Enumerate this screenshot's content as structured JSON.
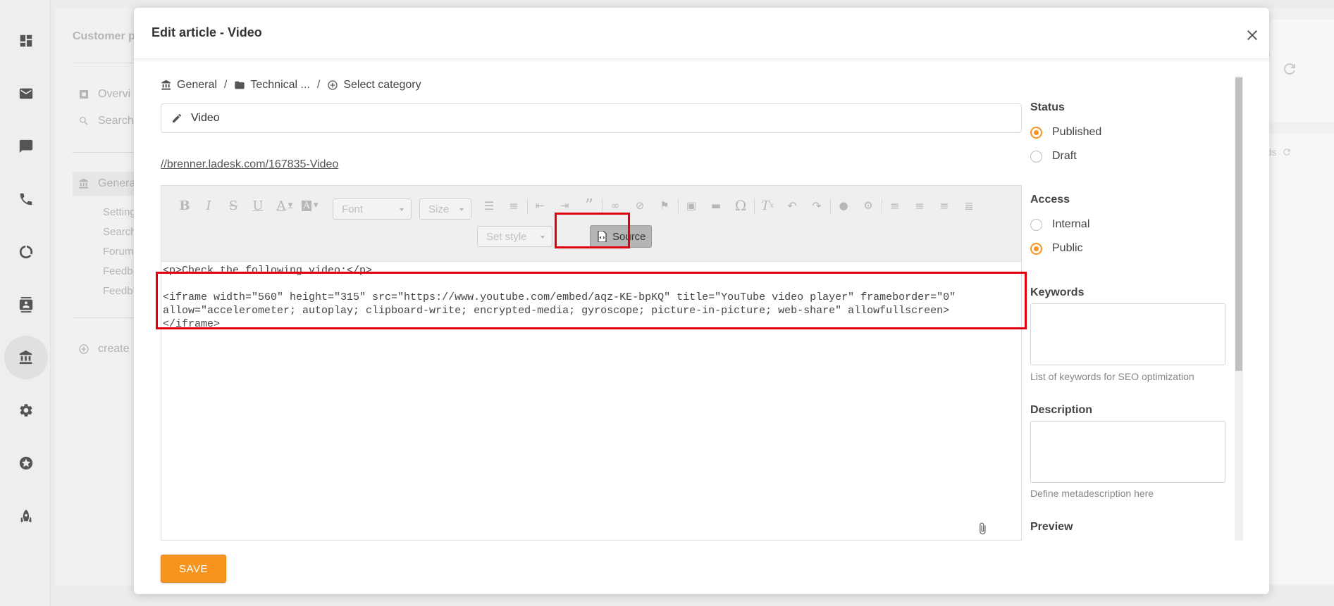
{
  "background": {
    "section_title": "Customer po",
    "items": [
      "Overvi",
      "Search"
    ],
    "selected_item": "Genera",
    "sub_items": [
      "Setting",
      "Search",
      "Forum",
      "Feedb",
      "Feedb"
    ],
    "create_label": "create",
    "right_text": "rds"
  },
  "modal": {
    "title": "Edit article - Video",
    "breadcrumb": {
      "root": "General",
      "separator": "/",
      "folder": "Technical ...",
      "select": "Select category"
    },
    "title_value": "Video",
    "link": "//brenner.ladesk.com/167835-Video",
    "editor": {
      "font_select": "Font",
      "size_select": "Size",
      "style_select": "Set style",
      "source_label": "Source",
      "code_lines": [
        "<p>Check the following video:</p>",
        "<iframe width=\"560\" height=\"315\" src=\"https://www.youtube.com/embed/aqz-KE-bpKQ\" title=\"YouTube video player\" frameborder=\"0\"",
        "allow=\"accelerometer; autoplay; clipboard-write; encrypted-media; gyroscope; picture-in-picture; web-share\" allowfullscreen>",
        "</iframe>"
      ]
    },
    "save_label": "SAVE",
    "side": {
      "status_label": "Status",
      "status_options": [
        "Published",
        "Draft"
      ],
      "status_selected": "Published",
      "access_label": "Access",
      "access_options": [
        "Internal",
        "Public"
      ],
      "access_selected": "Public",
      "keywords_label": "Keywords",
      "keywords_value": "",
      "keywords_hint": "List of keywords for SEO optimization",
      "description_label": "Description",
      "description_value": "",
      "description_hint": "Define metadescription here",
      "preview_label": "Preview"
    }
  },
  "colors": {
    "accent": "#f7941d",
    "highlight": "#e0000f"
  }
}
